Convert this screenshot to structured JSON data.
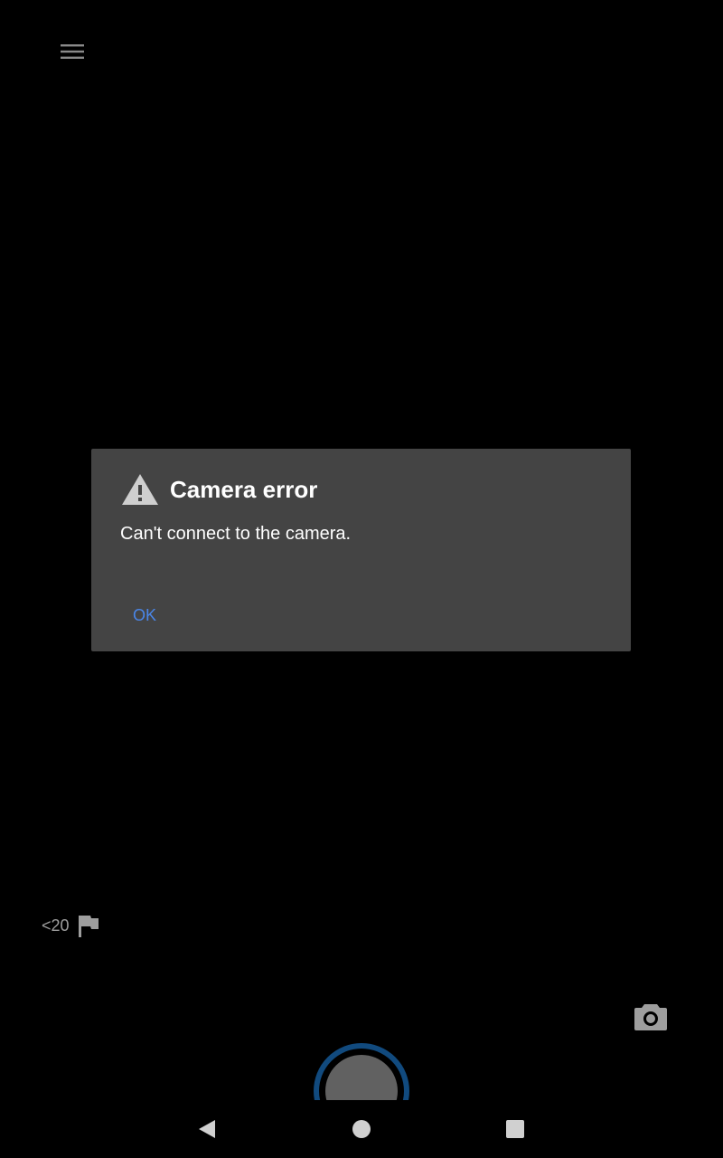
{
  "toolbar": {
    "menu_icon": "hamburger-menu-icon"
  },
  "dialog": {
    "icon": "warning-icon",
    "title": "Camera error",
    "message": "Can't connect to the camera.",
    "ok_label": "OK",
    "accent_color": "#4a86e8",
    "background_color": "#444444"
  },
  "status": {
    "storage_text": "<20",
    "storage_icon": "flag-icon"
  },
  "controls": {
    "switch_camera_icon": "camera-icon",
    "shutter_ring_color": "#114a7e"
  },
  "navigation": {
    "back_icon": "back-triangle-icon",
    "home_icon": "home-circle-icon",
    "recents_icon": "recents-square-icon"
  }
}
